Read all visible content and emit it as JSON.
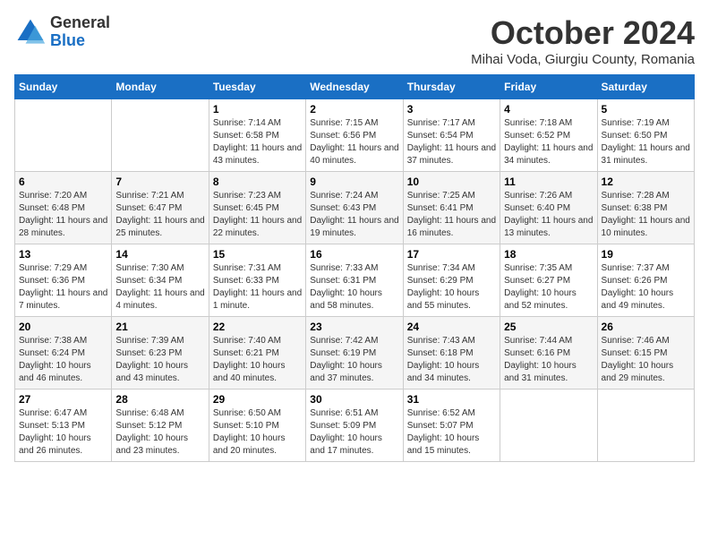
{
  "logo": {
    "general": "General",
    "blue": "Blue"
  },
  "title": "October 2024",
  "location": "Mihai Voda, Giurgiu County, Romania",
  "weekdays": [
    "Sunday",
    "Monday",
    "Tuesday",
    "Wednesday",
    "Thursday",
    "Friday",
    "Saturday"
  ],
  "weeks": [
    [
      {
        "day": "",
        "info": ""
      },
      {
        "day": "",
        "info": ""
      },
      {
        "day": "1",
        "info": "Sunrise: 7:14 AM\nSunset: 6:58 PM\nDaylight: 11 hours and 43 minutes."
      },
      {
        "day": "2",
        "info": "Sunrise: 7:15 AM\nSunset: 6:56 PM\nDaylight: 11 hours and 40 minutes."
      },
      {
        "day": "3",
        "info": "Sunrise: 7:17 AM\nSunset: 6:54 PM\nDaylight: 11 hours and 37 minutes."
      },
      {
        "day": "4",
        "info": "Sunrise: 7:18 AM\nSunset: 6:52 PM\nDaylight: 11 hours and 34 minutes."
      },
      {
        "day": "5",
        "info": "Sunrise: 7:19 AM\nSunset: 6:50 PM\nDaylight: 11 hours and 31 minutes."
      }
    ],
    [
      {
        "day": "6",
        "info": "Sunrise: 7:20 AM\nSunset: 6:48 PM\nDaylight: 11 hours and 28 minutes."
      },
      {
        "day": "7",
        "info": "Sunrise: 7:21 AM\nSunset: 6:47 PM\nDaylight: 11 hours and 25 minutes."
      },
      {
        "day": "8",
        "info": "Sunrise: 7:23 AM\nSunset: 6:45 PM\nDaylight: 11 hours and 22 minutes."
      },
      {
        "day": "9",
        "info": "Sunrise: 7:24 AM\nSunset: 6:43 PM\nDaylight: 11 hours and 19 minutes."
      },
      {
        "day": "10",
        "info": "Sunrise: 7:25 AM\nSunset: 6:41 PM\nDaylight: 11 hours and 16 minutes."
      },
      {
        "day": "11",
        "info": "Sunrise: 7:26 AM\nSunset: 6:40 PM\nDaylight: 11 hours and 13 minutes."
      },
      {
        "day": "12",
        "info": "Sunrise: 7:28 AM\nSunset: 6:38 PM\nDaylight: 11 hours and 10 minutes."
      }
    ],
    [
      {
        "day": "13",
        "info": "Sunrise: 7:29 AM\nSunset: 6:36 PM\nDaylight: 11 hours and 7 minutes."
      },
      {
        "day": "14",
        "info": "Sunrise: 7:30 AM\nSunset: 6:34 PM\nDaylight: 11 hours and 4 minutes."
      },
      {
        "day": "15",
        "info": "Sunrise: 7:31 AM\nSunset: 6:33 PM\nDaylight: 11 hours and 1 minute."
      },
      {
        "day": "16",
        "info": "Sunrise: 7:33 AM\nSunset: 6:31 PM\nDaylight: 10 hours and 58 minutes."
      },
      {
        "day": "17",
        "info": "Sunrise: 7:34 AM\nSunset: 6:29 PM\nDaylight: 10 hours and 55 minutes."
      },
      {
        "day": "18",
        "info": "Sunrise: 7:35 AM\nSunset: 6:27 PM\nDaylight: 10 hours and 52 minutes."
      },
      {
        "day": "19",
        "info": "Sunrise: 7:37 AM\nSunset: 6:26 PM\nDaylight: 10 hours and 49 minutes."
      }
    ],
    [
      {
        "day": "20",
        "info": "Sunrise: 7:38 AM\nSunset: 6:24 PM\nDaylight: 10 hours and 46 minutes."
      },
      {
        "day": "21",
        "info": "Sunrise: 7:39 AM\nSunset: 6:23 PM\nDaylight: 10 hours and 43 minutes."
      },
      {
        "day": "22",
        "info": "Sunrise: 7:40 AM\nSunset: 6:21 PM\nDaylight: 10 hours and 40 minutes."
      },
      {
        "day": "23",
        "info": "Sunrise: 7:42 AM\nSunset: 6:19 PM\nDaylight: 10 hours and 37 minutes."
      },
      {
        "day": "24",
        "info": "Sunrise: 7:43 AM\nSunset: 6:18 PM\nDaylight: 10 hours and 34 minutes."
      },
      {
        "day": "25",
        "info": "Sunrise: 7:44 AM\nSunset: 6:16 PM\nDaylight: 10 hours and 31 minutes."
      },
      {
        "day": "26",
        "info": "Sunrise: 7:46 AM\nSunset: 6:15 PM\nDaylight: 10 hours and 29 minutes."
      }
    ],
    [
      {
        "day": "27",
        "info": "Sunrise: 6:47 AM\nSunset: 5:13 PM\nDaylight: 10 hours and 26 minutes."
      },
      {
        "day": "28",
        "info": "Sunrise: 6:48 AM\nSunset: 5:12 PM\nDaylight: 10 hours and 23 minutes."
      },
      {
        "day": "29",
        "info": "Sunrise: 6:50 AM\nSunset: 5:10 PM\nDaylight: 10 hours and 20 minutes."
      },
      {
        "day": "30",
        "info": "Sunrise: 6:51 AM\nSunset: 5:09 PM\nDaylight: 10 hours and 17 minutes."
      },
      {
        "day": "31",
        "info": "Sunrise: 6:52 AM\nSunset: 5:07 PM\nDaylight: 10 hours and 15 minutes."
      },
      {
        "day": "",
        "info": ""
      },
      {
        "day": "",
        "info": ""
      }
    ]
  ]
}
